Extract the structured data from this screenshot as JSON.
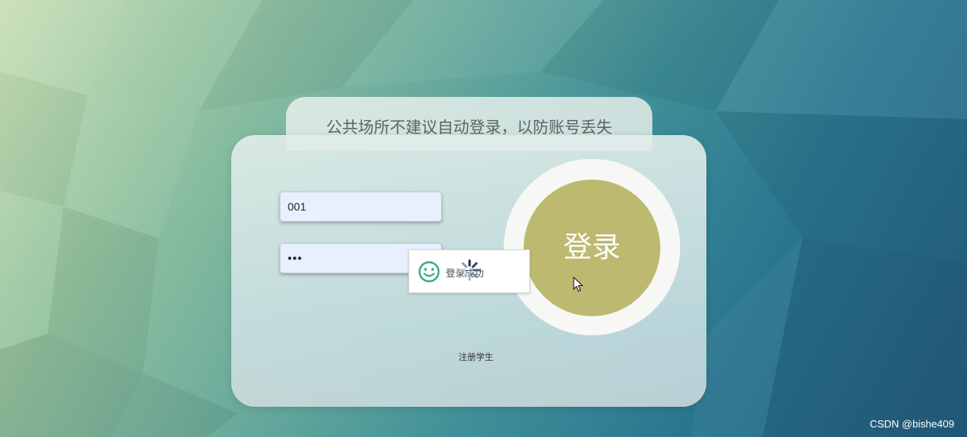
{
  "tip": {
    "text": "公共场所不建议自动登录，以防账号丢失"
  },
  "form": {
    "username_value": "001",
    "password_value": "•••"
  },
  "login_button": {
    "label": "登录",
    "color": "#bdb970"
  },
  "register_link": {
    "label": "注册学生"
  },
  "toast": {
    "icon": "smile-icon",
    "message": "登录成功",
    "icon_color": "#3aaa8c"
  },
  "watermark": {
    "text": "CSDN @bishe409"
  }
}
